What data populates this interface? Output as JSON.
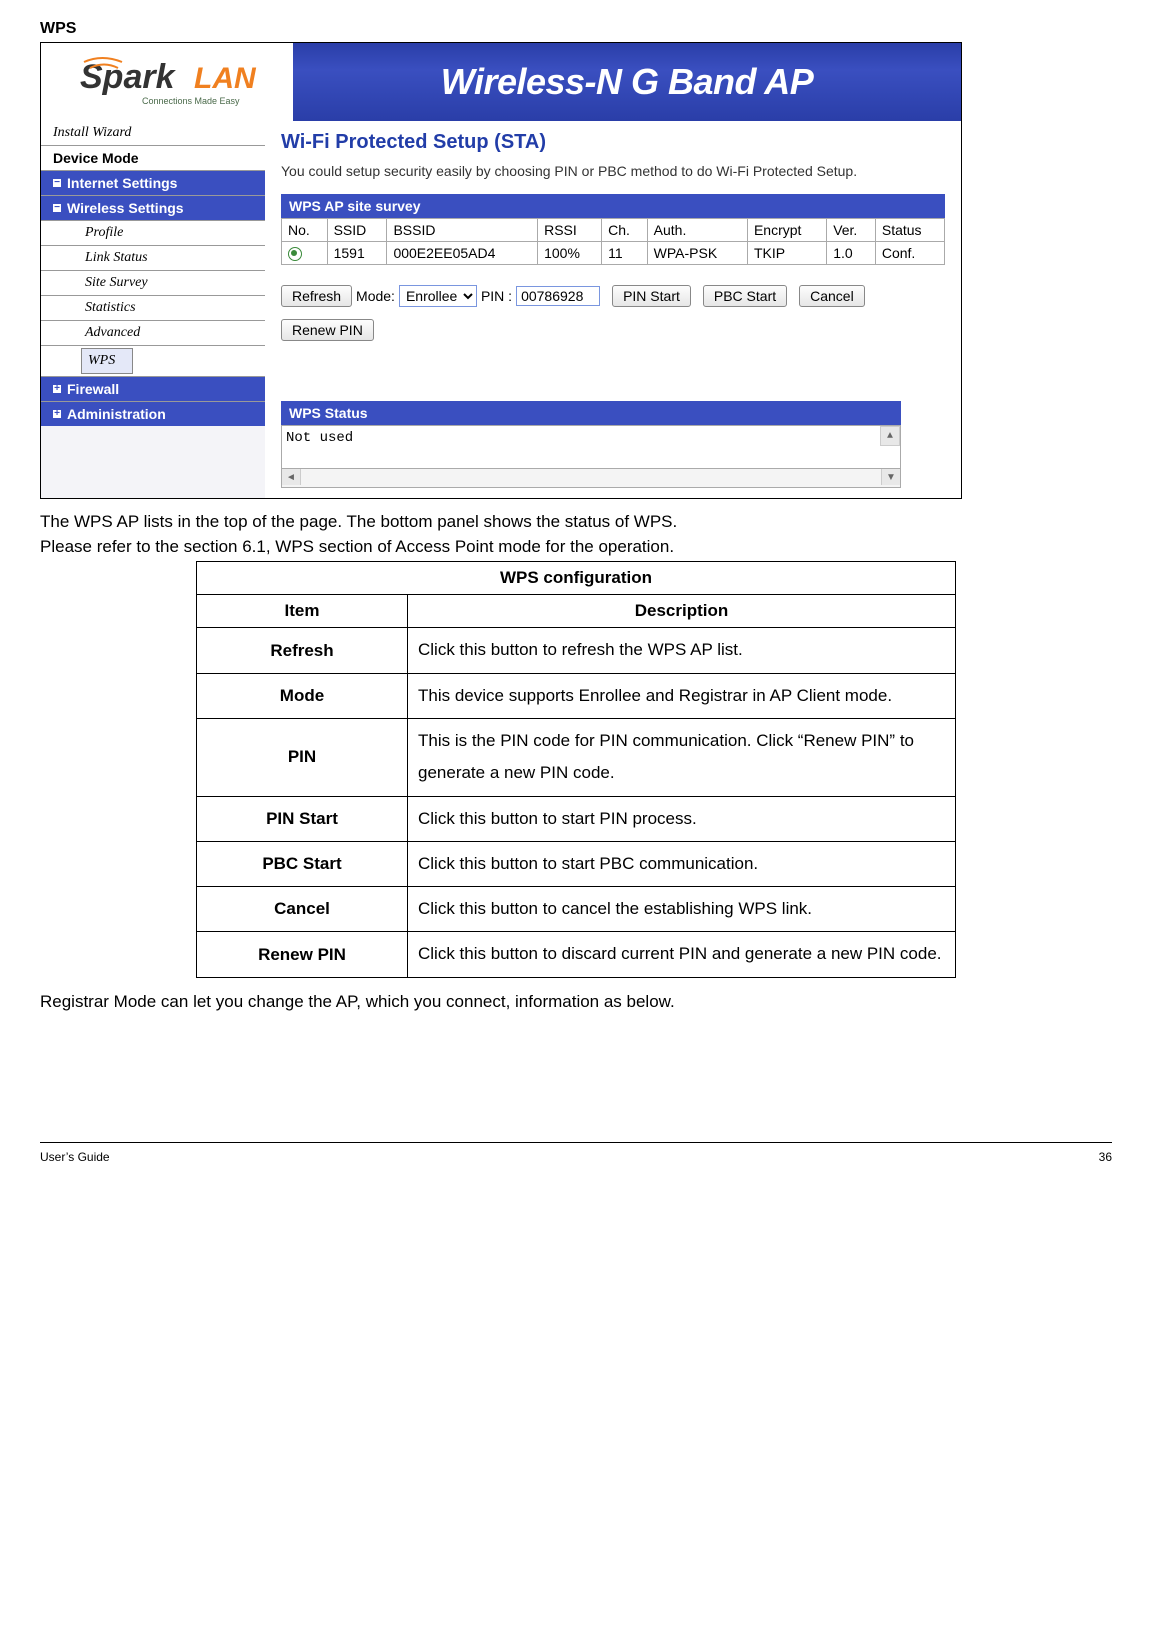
{
  "section_title": "WPS",
  "banner": {
    "logo_text_accent": "LAN",
    "logo_tagline": "Connections Made Easy",
    "headline": "Wireless-N G Band AP"
  },
  "nav": {
    "install_wizard": "Install Wizard",
    "device_mode": "Device Mode",
    "internet_settings": "Internet Settings",
    "wireless_settings": "Wireless Settings",
    "subs": {
      "profile": "Profile",
      "link_status": "Link Status",
      "site_survey": "Site Survey",
      "statistics": "Statistics",
      "advanced": "Advanced",
      "wps": "WPS"
    },
    "firewall": "Firewall",
    "administration": "Administration"
  },
  "main": {
    "title": "Wi-Fi Protected Setup (STA)",
    "description": "You could setup security easily by choosing PIN or PBC method to do Wi-Fi Protected Setup.",
    "survey_header": "WPS AP site survey",
    "cols": {
      "no": "No.",
      "ssid": "SSID",
      "bssid": "BSSID",
      "rssi": "RSSI",
      "ch": "Ch.",
      "auth": "Auth.",
      "encrypt": "Encrypt",
      "ver": "Ver.",
      "status": "Status"
    },
    "row0": {
      "ssid": "1591",
      "bssid": "000E2EE05AD4",
      "rssi": "100%",
      "ch": "11",
      "auth": "WPA-PSK",
      "encrypt": "TKIP",
      "ver": "1.0",
      "status": "Conf."
    },
    "controls": {
      "refresh": "Refresh",
      "mode_label": "Mode:",
      "mode_value": "Enrollee",
      "pin_label": "PIN :",
      "pin_value": "00786928",
      "pin_start": "PIN Start",
      "pbc_start": "PBC Start",
      "cancel": "Cancel",
      "renew_pin": "Renew PIN"
    },
    "wps_status": {
      "header": "WPS Status",
      "content": "Not used"
    }
  },
  "text": {
    "p1": "The WPS AP lists in the top of the page. The bottom panel shows the status of WPS.",
    "p2": "Please refer to the section 6.1, WPS section of Access Point mode for the operation.",
    "closing": "Registrar Mode can let you change the AP, which you connect, information as below."
  },
  "config_table": {
    "title": "WPS configuration",
    "item_header": "Item",
    "desc_header": "Description",
    "rows": {
      "refresh": {
        "item": "Refresh",
        "desc": "Click this button to refresh the WPS AP list."
      },
      "mode": {
        "item": "Mode",
        "desc": "This device supports Enrollee and Registrar in AP Client mode."
      },
      "pin": {
        "item": "PIN",
        "desc": "This is the PIN code for PIN communication. Click “Renew PIN” to generate a new PIN code."
      },
      "pin_start": {
        "item": "PIN Start",
        "desc": "Click this button to start PIN process."
      },
      "pbc_start": {
        "item": "PBC Start",
        "desc": "Click this button to start PBC communication."
      },
      "cancel": {
        "item": "Cancel",
        "desc": "Click this button to cancel the establishing WPS link."
      },
      "renew_pin": {
        "item": "Renew PIN",
        "desc": "Click this button to discard current PIN and generate a new PIN code."
      }
    }
  },
  "footer": {
    "left": "User’s Guide",
    "right": "36"
  }
}
